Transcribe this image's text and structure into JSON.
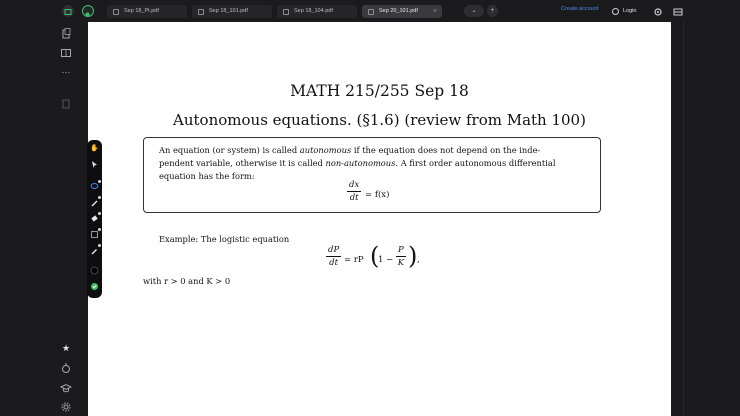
{
  "tabs": [
    {
      "label": "Sep 18_Pt.pdf"
    },
    {
      "label": "Sep 18_101.pdf"
    },
    {
      "label": "Sep 18_104.pdf"
    },
    {
      "label": "Sep 20_101.pdf"
    }
  ],
  "topbar": {
    "nav_chevron": "⌄",
    "add_tab": "+",
    "create_account": "Create account",
    "login": "Login"
  },
  "colors": {
    "background": "#1b1b1d",
    "link": "#4a8cf0",
    "green": "#3fbf6a",
    "page": "#ffffff"
  },
  "icons": {
    "topbar": [
      "sidebar-toggle-icon",
      "app-logo-icon",
      "document-icon",
      "close-icon",
      "chevron-down-icon",
      "plus-icon",
      "user-icon",
      "settings-icon",
      "tray-icon"
    ],
    "sidebar": [
      "copy-icon",
      "notebook-icon",
      "more-icon",
      "page-icon",
      "star-icon",
      "timer-icon",
      "graduation-cap-icon",
      "gear-icon"
    ],
    "toolbar": [
      "hand-icon",
      "cursor-icon",
      "lasso-icon",
      "pen-icon",
      "highlighter-icon",
      "ruler-icon",
      "eyedropper-icon",
      "color-black-icon",
      "color-green-icon"
    ]
  },
  "document": {
    "title": "MATH 215/255 Sep 18",
    "subtitle": "Autonomous equations. (§1.6) (review from Math 100)",
    "definition": {
      "line1_pre": "An equation (or system) is called ",
      "line1_em": "autonomous",
      "line1_post": " if the equation does not depend on the inde-",
      "line2_pre": "pendent variable, otherwise it is called ",
      "line2_em": "non-autonomous",
      "line2_post": ". A first order autonomous differential",
      "line3": "equation has the form:",
      "eq_num": "dx",
      "eq_den": "dt",
      "eq_rhs": "= f(x)"
    },
    "example": {
      "label": "Example: The logistic equation",
      "lhs_num": "dP",
      "lhs_den": "dt",
      "equals": "= rP",
      "open_paren": "(",
      "one_minus": "1 −",
      "frac_num": "P",
      "frac_den": "K",
      "close_paren": ")",
      "comma": ",",
      "conditions": "with r > 0 and K > 0"
    }
  }
}
